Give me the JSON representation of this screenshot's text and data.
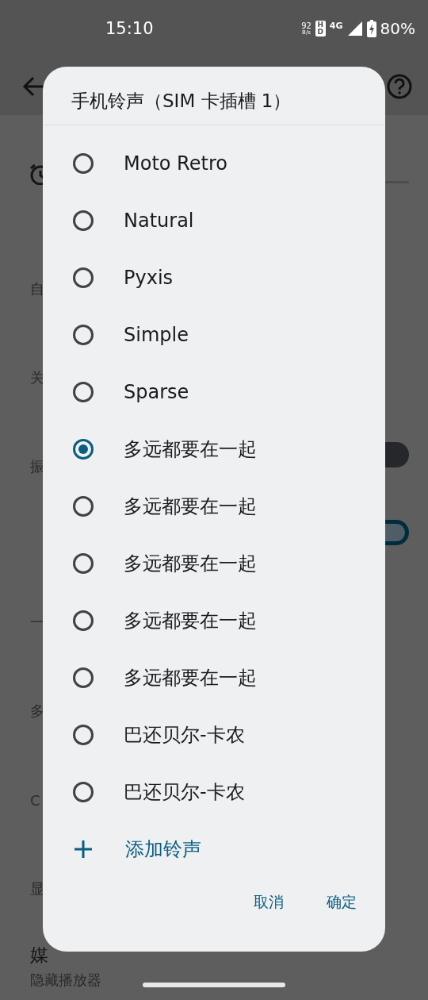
{
  "status_bar": {
    "time": "15:10",
    "net_speed": "92",
    "net_unit": "B/s",
    "hd": "HD",
    "network": "4G",
    "battery": "80%",
    "charging": true
  },
  "settings": [
    {
      "kind": "text",
      "subtitle": "自"
    },
    {
      "kind": "text",
      "subtitle": "关"
    },
    {
      "kind": "switch",
      "subtitle": "振",
      "on": false
    },
    {
      "kind": "switch",
      "on": true
    },
    {
      "kind": "text",
      "subtitle": "一"
    },
    {
      "kind": "text",
      "subtitle": "多"
    },
    {
      "kind": "text",
      "subtitle": "C"
    },
    {
      "kind": "text",
      "subtitle": "显"
    },
    {
      "kind": "text",
      "title": "媒",
      "subtitle": "隐藏播放器"
    }
  ],
  "dialog": {
    "title": "手机铃声（SIM 卡插槽 1）",
    "options": [
      {
        "label": "Moto Retro",
        "selected": false
      },
      {
        "label": "Natural",
        "selected": false
      },
      {
        "label": "Pyxis",
        "selected": false
      },
      {
        "label": "Simple",
        "selected": false
      },
      {
        "label": "Sparse",
        "selected": false
      },
      {
        "label": "多远都要在一起",
        "selected": true
      },
      {
        "label": "多远都要在一起",
        "selected": false
      },
      {
        "label": "多远都要在一起",
        "selected": false
      },
      {
        "label": "多远都要在一起",
        "selected": false
      },
      {
        "label": "多远都要在一起",
        "selected": false
      },
      {
        "label": "巴还贝尔-卡农",
        "selected": false
      },
      {
        "label": "巴还贝尔-卡农",
        "selected": false
      }
    ],
    "add_label": "添加铃声",
    "buttons": [
      "取消",
      "确定"
    ]
  }
}
